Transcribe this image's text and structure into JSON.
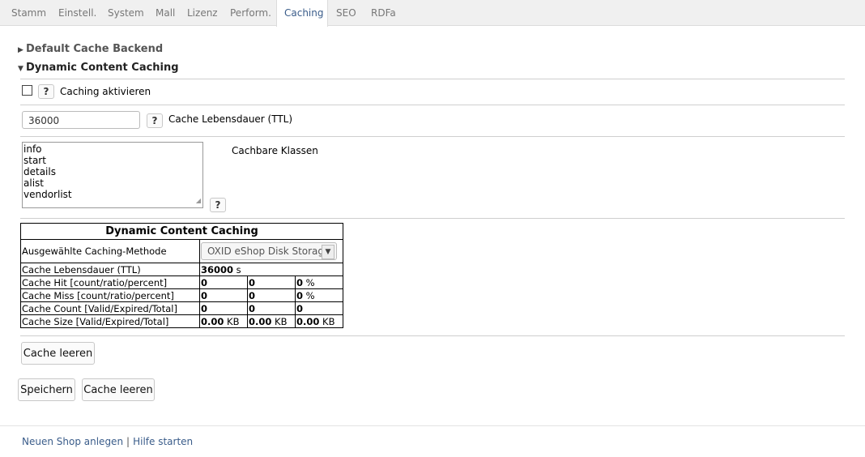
{
  "tabs": [
    "Stamm",
    "Einstell.",
    "System",
    "Mall",
    "Lizenz",
    "Perform.",
    "Caching",
    "SEO",
    "RDFa"
  ],
  "sections": {
    "default_backend": "Default Cache Backend",
    "dynamic_content": "Dynamic Content Caching"
  },
  "caching_active": {
    "label": "Caching aktivieren",
    "checked": false
  },
  "help_symbol": "?",
  "ttl": {
    "value": "36000",
    "label": "Cache Lebensdauer (TTL)"
  },
  "cacheable_classes": {
    "label": "Cachbare Klassen",
    "items": [
      "info",
      "start",
      "details",
      "alist",
      "vendorlist"
    ]
  },
  "stats": {
    "title": "Dynamic Content Caching",
    "method_label": "Ausgewählte Caching-Methode",
    "method_value": "OXID eShop Disk Storage",
    "ttl_label": "Cache Lebensdauer (TTL)",
    "ttl_value": "36000",
    "ttl_unit": "s",
    "hit_label": "Cache Hit [count/ratio/percent]",
    "hit": [
      "0",
      "0",
      "0"
    ],
    "miss_label": "Cache Miss [count/ratio/percent]",
    "miss": [
      "0",
      "0",
      "0"
    ],
    "percent_unit": "%",
    "count_label": "Cache Count [Valid/Expired/Total]",
    "count": [
      "0",
      "0",
      "0"
    ],
    "size_label": "Cache Size [Valid/Expired/Total]",
    "size": [
      "0.00",
      "0.00",
      "0.00"
    ],
    "size_unit": "KB"
  },
  "buttons": {
    "clear_cache_inner": "Cache leeren",
    "save": "Speichern",
    "clear_cache": "Cache leeren"
  },
  "footer": {
    "new_shop": "Neuen Shop anlegen",
    "separator": "|",
    "help": "Hilfe starten"
  }
}
